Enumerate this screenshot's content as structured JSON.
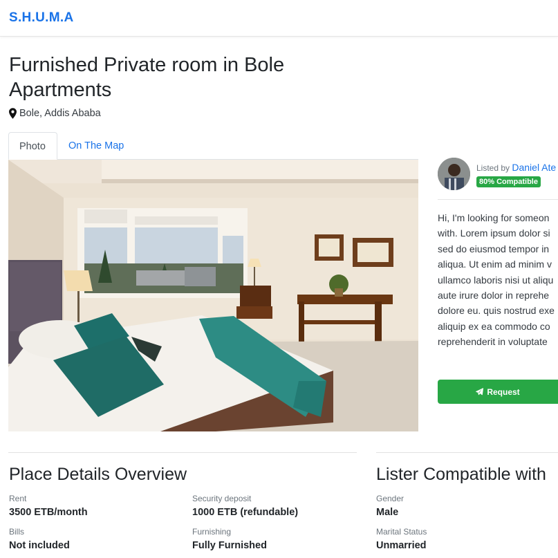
{
  "navbar": {
    "brand": "S.H.U.M.A"
  },
  "listing": {
    "title": "Furnished Private room in Bole Apartments",
    "location": "Bole, Addis Ababa",
    "location_icon": "map-marker-icon"
  },
  "tabs": [
    {
      "label": "Photo",
      "active": true
    },
    {
      "label": "On The Map",
      "active": false
    }
  ],
  "lister": {
    "listed_by_label": "Listed by",
    "name": "Daniel Ate",
    "compatibility_badge": "80% Compatible",
    "bio_lines": [
      "Hi, I'm looking for someon",
      "with. Lorem ipsum dolor si",
      "sed do eiusmod tempor in",
      "aliqua. Ut enim ad minim v",
      "ullamco laboris nisi ut aliqu",
      "aute irure dolor in reprehe",
      "dolore eu. quis nostrud exe",
      "aliquip ex ea commodo co",
      "reprehenderit in voluptate"
    ],
    "request_label": "Request",
    "request_icon": "paper-plane-icon"
  },
  "place_details": {
    "title": "Place Details Overview",
    "fields": [
      {
        "label": "Rent",
        "value": "3500 ETB/month"
      },
      {
        "label": "Security deposit",
        "value": "1000 ETB (refundable)"
      },
      {
        "label": "Bills",
        "value": "Not included"
      },
      {
        "label": "Furnishing",
        "value": "Fully Furnished"
      }
    ]
  },
  "lister_compatible": {
    "title": "Lister Compatible with",
    "fields": [
      {
        "label": "Gender",
        "value": "Male"
      },
      {
        "label": "Marital Status",
        "value": "Unmarried"
      }
    ]
  },
  "colors": {
    "brand": "#1a73e8",
    "success": "#28a745",
    "text": "#212529",
    "muted": "#6c757d"
  }
}
